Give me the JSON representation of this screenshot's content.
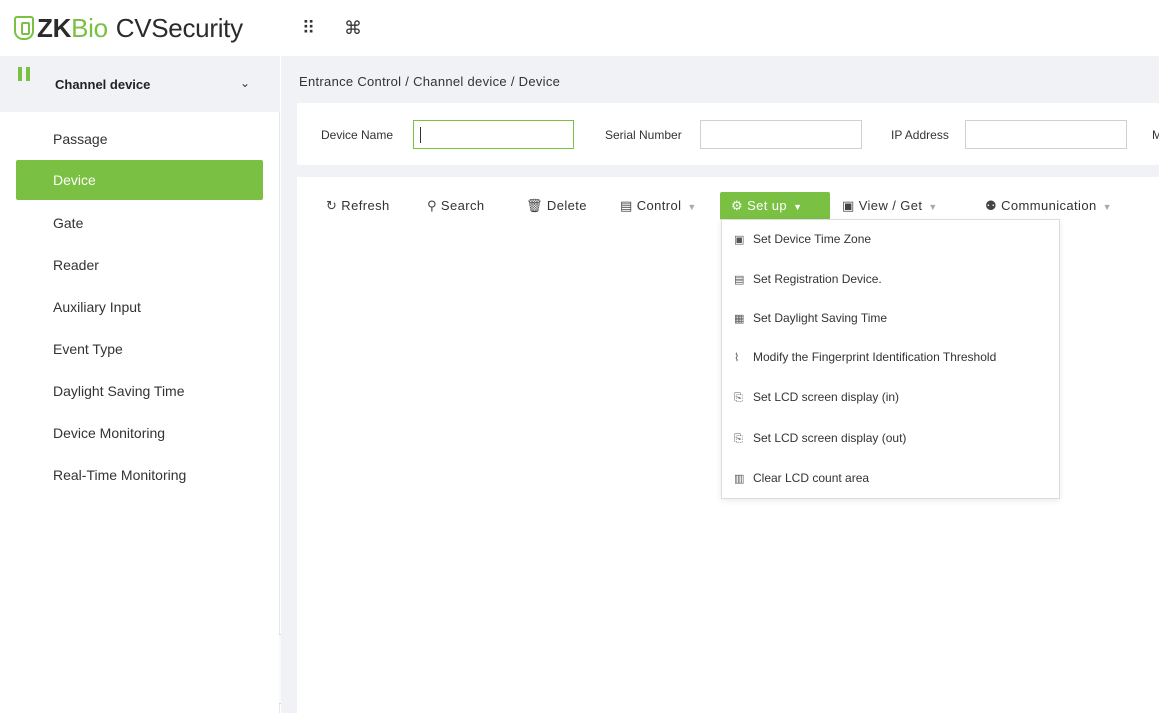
{
  "app": {
    "logo_zk": "ZK",
    "logo_bio": "Bio",
    "logo_cv": "CVSecurity",
    "grid_icon": "⠿",
    "command_icon": "⌘"
  },
  "sidebar": {
    "header_label": "Channel device",
    "header_chevron": "⌄",
    "items": [
      {
        "label": "Passage"
      },
      {
        "label": "Device"
      },
      {
        "label": "Gate"
      },
      {
        "label": "Reader"
      },
      {
        "label": "Auxiliary Input"
      },
      {
        "label": "Event Type"
      },
      {
        "label": "Daylight Saving Time"
      },
      {
        "label": "Device Monitoring"
      },
      {
        "label": "Real-Time Monitoring"
      }
    ],
    "active_item": "Device",
    "collapse_glyph": "«"
  },
  "breadcrumb": "Entrance Control / Channel device / Device",
  "filters": {
    "device_name_label": "Device Name",
    "device_name_value": "",
    "serial_number_label": "Serial Number",
    "serial_number_value": "",
    "ip_address_label": "IP Address",
    "ip_address_value": "",
    "truncated_label": "M"
  },
  "toolbar": {
    "refresh": {
      "label": "Refresh",
      "icon": "↻"
    },
    "search": {
      "label": "Search",
      "icon": "⚲"
    },
    "delete": {
      "label": "Delete",
      "icon": "🗑"
    },
    "control": {
      "label": "Control",
      "icon": "▤"
    },
    "setup": {
      "label": "Set up",
      "icon": "⚙"
    },
    "view_get": {
      "label": "View / Get",
      "icon": "▣"
    },
    "communication": {
      "label": "Communication",
      "icon": "⚉"
    },
    "dropdown_arrow": "▼"
  },
  "setup_menu": [
    {
      "label": "Set Device Time Zone",
      "icon": "▣"
    },
    {
      "label": "Set Registration Device.",
      "icon": "▤"
    },
    {
      "label": "Set Daylight Saving Time",
      "icon": "▦"
    },
    {
      "label": "Modify the Fingerprint Identification Threshold",
      "icon": "⌇"
    },
    {
      "label": "Set LCD screen display (in)",
      "icon": "⎘"
    },
    {
      "label": "Set LCD screen display (out)",
      "icon": "⎘"
    },
    {
      "label": "Clear LCD count area",
      "icon": "▥"
    }
  ],
  "colors": {
    "accent": "#7ac143",
    "background": "#f0f2f5"
  }
}
